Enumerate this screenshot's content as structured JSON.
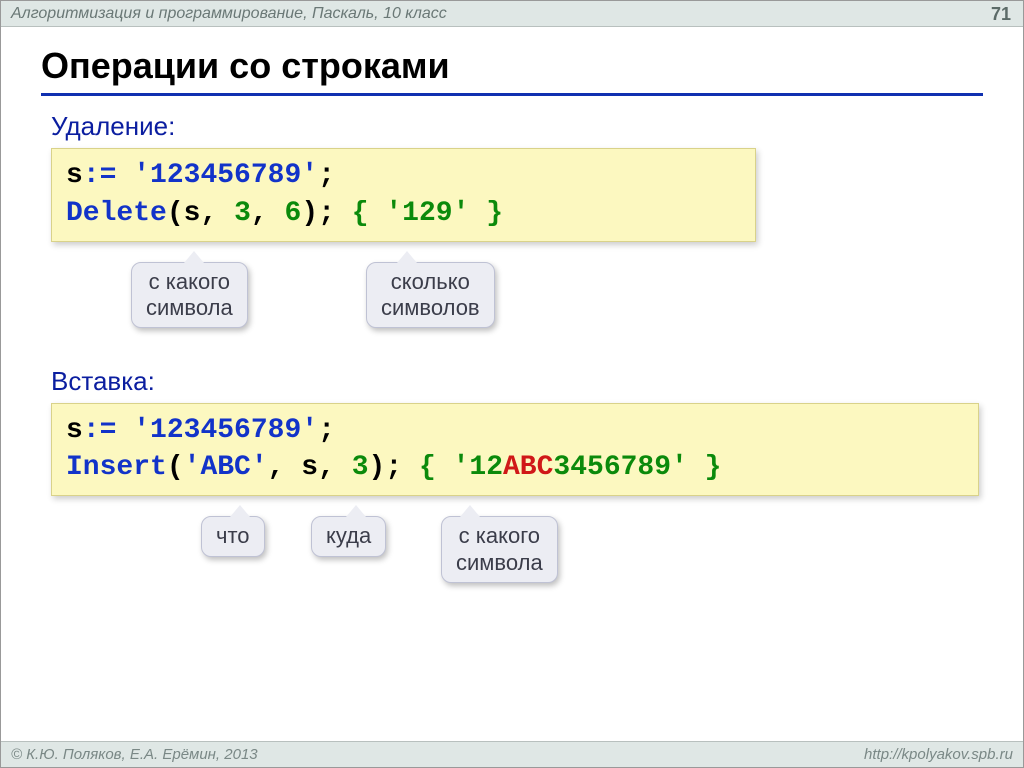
{
  "header": {
    "subject": "Алгоритмизация и программирование, Паскаль, 10 класс",
    "page": "71"
  },
  "title": "Операции со строками",
  "section1": {
    "label": "Удаление:",
    "code": {
      "line1": {
        "var": "s",
        "assign": ":=",
        "space": " ",
        "lit": "'123456789'",
        "semi": ";"
      },
      "line2": {
        "fn": "Delete",
        "open": "(",
        "arg1": "s",
        "c1": ",",
        "sp1": " ",
        "arg2": "3",
        "c2": ",",
        "sp2": " ",
        "arg3": "6",
        "close": ")",
        "semi": ";",
        "sp3": " ",
        "cmt_open": "{ ",
        "cmt": "'129'",
        "cmt_close": " }"
      }
    },
    "bubble1": "с какого\nсимвола",
    "bubble2": "сколько\nсимволов"
  },
  "section2": {
    "label": "Вставка:",
    "code": {
      "line1": {
        "var": "s",
        "assign": ":=",
        "space": " ",
        "lit": "'123456789'",
        "semi": ";"
      },
      "line2": {
        "fn": "Insert",
        "open": "(",
        "arg1": "'ABC'",
        "c1": ",",
        "sp1": " ",
        "arg2": "s",
        "c2": ",",
        "sp2": " ",
        "arg3": "3",
        "close": ")",
        "semi": ";",
        "sp3": " ",
        "cmt_open": "{ '",
        "cmt_a": "12",
        "cmt_b": "ABC",
        "cmt_c": "3456789",
        "cmt_close": "' }"
      }
    },
    "bubble1": "что",
    "bubble2": "куда",
    "bubble3": "с какого\nсимвола"
  },
  "footer": {
    "left": "© К.Ю. Поляков, Е.А. Ерёмин, 2013",
    "right": "http://kpolyakov.spb.ru"
  }
}
